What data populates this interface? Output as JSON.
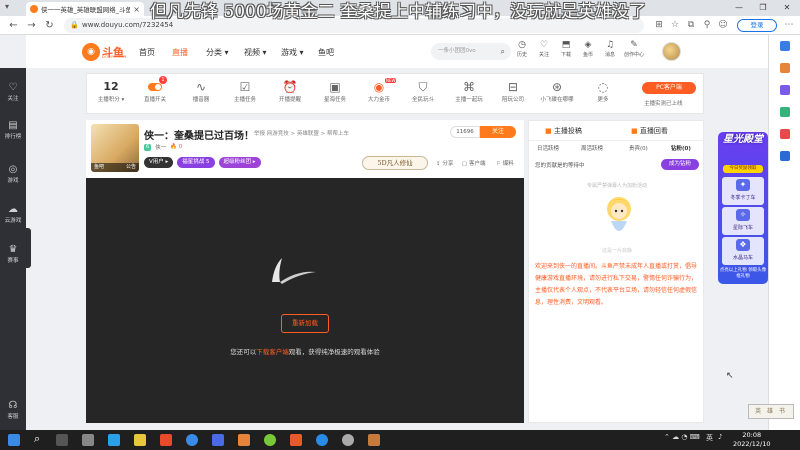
{
  "browser": {
    "tab_title": "侠一一英雄_英雄联盟网络_斗鱼直播",
    "tab_close": "×",
    "new_tab": "+",
    "url": "www.douyu.com/7232454",
    "login_label": "登录",
    "win_min": "—",
    "win_max": "❐",
    "win_close": "✕"
  },
  "danmaku": "但凡先锋 5000场黄金二 奎桑提上中辅练习中，没玩就是英雄没了",
  "left_sidebar": [
    {
      "label": "关注"
    },
    {
      "label": "排行榜"
    },
    {
      "label": "游戏"
    },
    {
      "label": "云游戏"
    },
    {
      "label": "赛事"
    },
    {
      "label": "客服"
    }
  ],
  "header": {
    "logo_text": "斗鱼",
    "logo_sub": "DOUYU.COM",
    "nav": [
      {
        "label": "首页"
      },
      {
        "label": "直播"
      },
      {
        "label": "分类 ▾"
      },
      {
        "label": "视频 ▾"
      },
      {
        "label": "游戏 ▾"
      },
      {
        "label": "鱼吧"
      }
    ],
    "search_placeholder": "一条小团团0vo",
    "icons": [
      {
        "label": "历史"
      },
      {
        "label": "关注"
      },
      {
        "label": "下载"
      },
      {
        "label": "鱼币"
      },
      {
        "label": "消息"
      },
      {
        "label": "创作中心"
      }
    ]
  },
  "toolbar": {
    "score_value": "12",
    "score_label": "主播积分 ▾",
    "items": [
      {
        "label": "直播开关"
      },
      {
        "label": "播音器"
      },
      {
        "label": "主播任务"
      },
      {
        "label": "开播提醒"
      },
      {
        "label": "星海任务"
      },
      {
        "label": "大力金币"
      },
      {
        "label": "全民玩斗"
      },
      {
        "label": "主播一起玩"
      },
      {
        "label": "陪玩公司"
      },
      {
        "label": "小飞碟在哪哪"
      },
      {
        "label": "更多"
      }
    ],
    "badge_count": "1",
    "new_label": "NEW",
    "pc_client_label": "PC客户端",
    "pc_client_sub": "主播实测已上线"
  },
  "room": {
    "title": "侠一：奎桑提已过百场！",
    "breadcrumb": "举报   网游竞技  >  英雄联盟  >  帮帮上车",
    "followers": "11696",
    "follow_label": "关注",
    "thumb_tags": [
      "鱼吧",
      "公告"
    ],
    "tag": "6",
    "streamer": "侠一",
    "heat": "🔥 0",
    "pills": [
      "V用户 ▸",
      "福星挑战  5",
      "超级粉丝团 ▸"
    ],
    "brand": "5D凡人修仙",
    "actions": [
      "分享",
      "客户端",
      "爆料"
    ]
  },
  "player": {
    "reload_label": "重新加载",
    "hint_before": "您还可以",
    "hint_link": "下载客户端",
    "hint_after": "观看，获得纯净极速的观看体验"
  },
  "right_panel": {
    "tabs": [
      "主播投稿",
      "直播回看"
    ],
    "subtabs": [
      "日活跃榜",
      "周活跃榜",
      "贵宾(0)",
      "钻粉(0)"
    ],
    "row_text": "您的贡献是的等待中",
    "row_button": "成为钻粉",
    "empty_hint": "专属严禁弹幕人为加粉活动",
    "empty_sub": "这是一片寂静",
    "notice": "欢迎来到侠一的直播间。斗鱼严禁未成年人直播或打赏，倡导健康游戏直播环境，请勿进行私下交易，警惕任何诈骗行为，主播仅代表个人观点，不代表平台立场，请勿轻信任何虚假信息，理性消费，文明观看。"
  },
  "promo": {
    "title": "星光殿堂",
    "subtitle": "今日奖励领取",
    "items": [
      "冬季卡丁车",
      "星际飞车",
      "水晶马车"
    ],
    "footer": "点亮以上礼物 领取头像框礼物"
  },
  "stamp": "英 雄 书",
  "taskbar": {
    "tray_text": "英",
    "time": "20:08",
    "date": "2022/12/10"
  }
}
